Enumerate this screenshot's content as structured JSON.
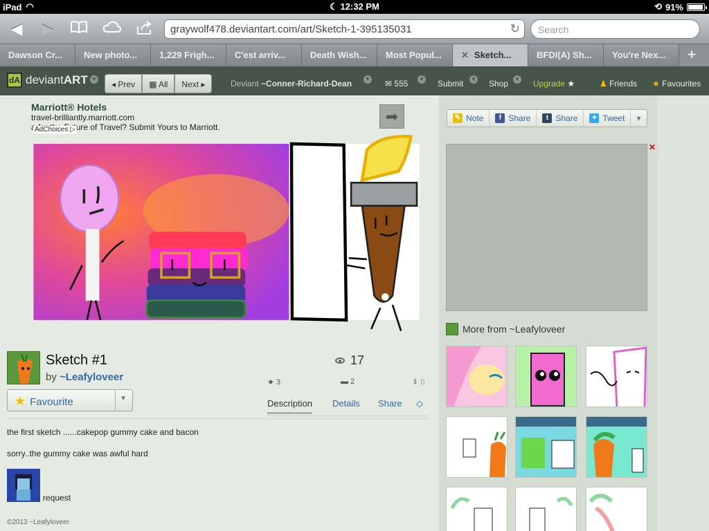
{
  "status": {
    "device": "iPad",
    "time": "12:32 PM",
    "battery": "91%"
  },
  "browser": {
    "url": "graywolf478.deviantart.com/art/Sketch-1-395135031",
    "search_placeholder": "Search",
    "tabs": [
      {
        "label": "Dawson Cr..."
      },
      {
        "label": "New photo..."
      },
      {
        "label": "1,229 Frigh..."
      },
      {
        "label": "C'est arriv..."
      },
      {
        "label": "Death Wish..."
      },
      {
        "label": "Most Popul..."
      },
      {
        "label": "Sketch..."
      },
      {
        "label": "BFDI(A) Sh..."
      },
      {
        "label": "You're Nex..."
      }
    ],
    "add_tab": "+"
  },
  "danav": {
    "logo_text": "deviant",
    "logo_bold": "ART",
    "prev": "Prev",
    "all": "All",
    "next": "Next",
    "deviant_prefix": "Deviant",
    "deviant_name": "~Conner-Richard-Dean",
    "messages_count": "555",
    "submit": "Submit",
    "shop": "Shop",
    "upgrade": "Upgrade",
    "friends": "Friends",
    "favourites": "Favourites"
  },
  "ad": {
    "title": "Marriott® Hotels",
    "url": "travel-brilliantly.marriott.com",
    "text": "a for the Future of Travel? Submit Yours to Marriott.",
    "tag": "AdChoices"
  },
  "deviation": {
    "title": "Sketch #1",
    "by": "by",
    "author": "~Leafyloveer",
    "views": "17",
    "favourite_label": "Favourite",
    "favs": "3",
    "comments": "2",
    "downloads": "0",
    "tabs": [
      "Description",
      "Details",
      "Share"
    ],
    "description": [
      "the first sketch ......cakepop gummy cake and bacon",
      "sorry..the gummy cake was awful hard"
    ],
    "request_label": "request",
    "copyright": "©2013 ~Leafyloveer"
  },
  "sidebar": {
    "share_buttons": [
      {
        "label": "Note",
        "icon": "note-icon"
      },
      {
        "label": "Share",
        "icon": "facebook-icon"
      },
      {
        "label": "Share",
        "icon": "tumblr-icon"
      },
      {
        "label": "Tweet",
        "icon": "twitter-icon"
      }
    ],
    "more_from": "More from ~Leafyloveer"
  },
  "colors": {
    "nav_bg": "#475449",
    "link": "#2f6aa8",
    "upgrade": "#b5d54a"
  }
}
